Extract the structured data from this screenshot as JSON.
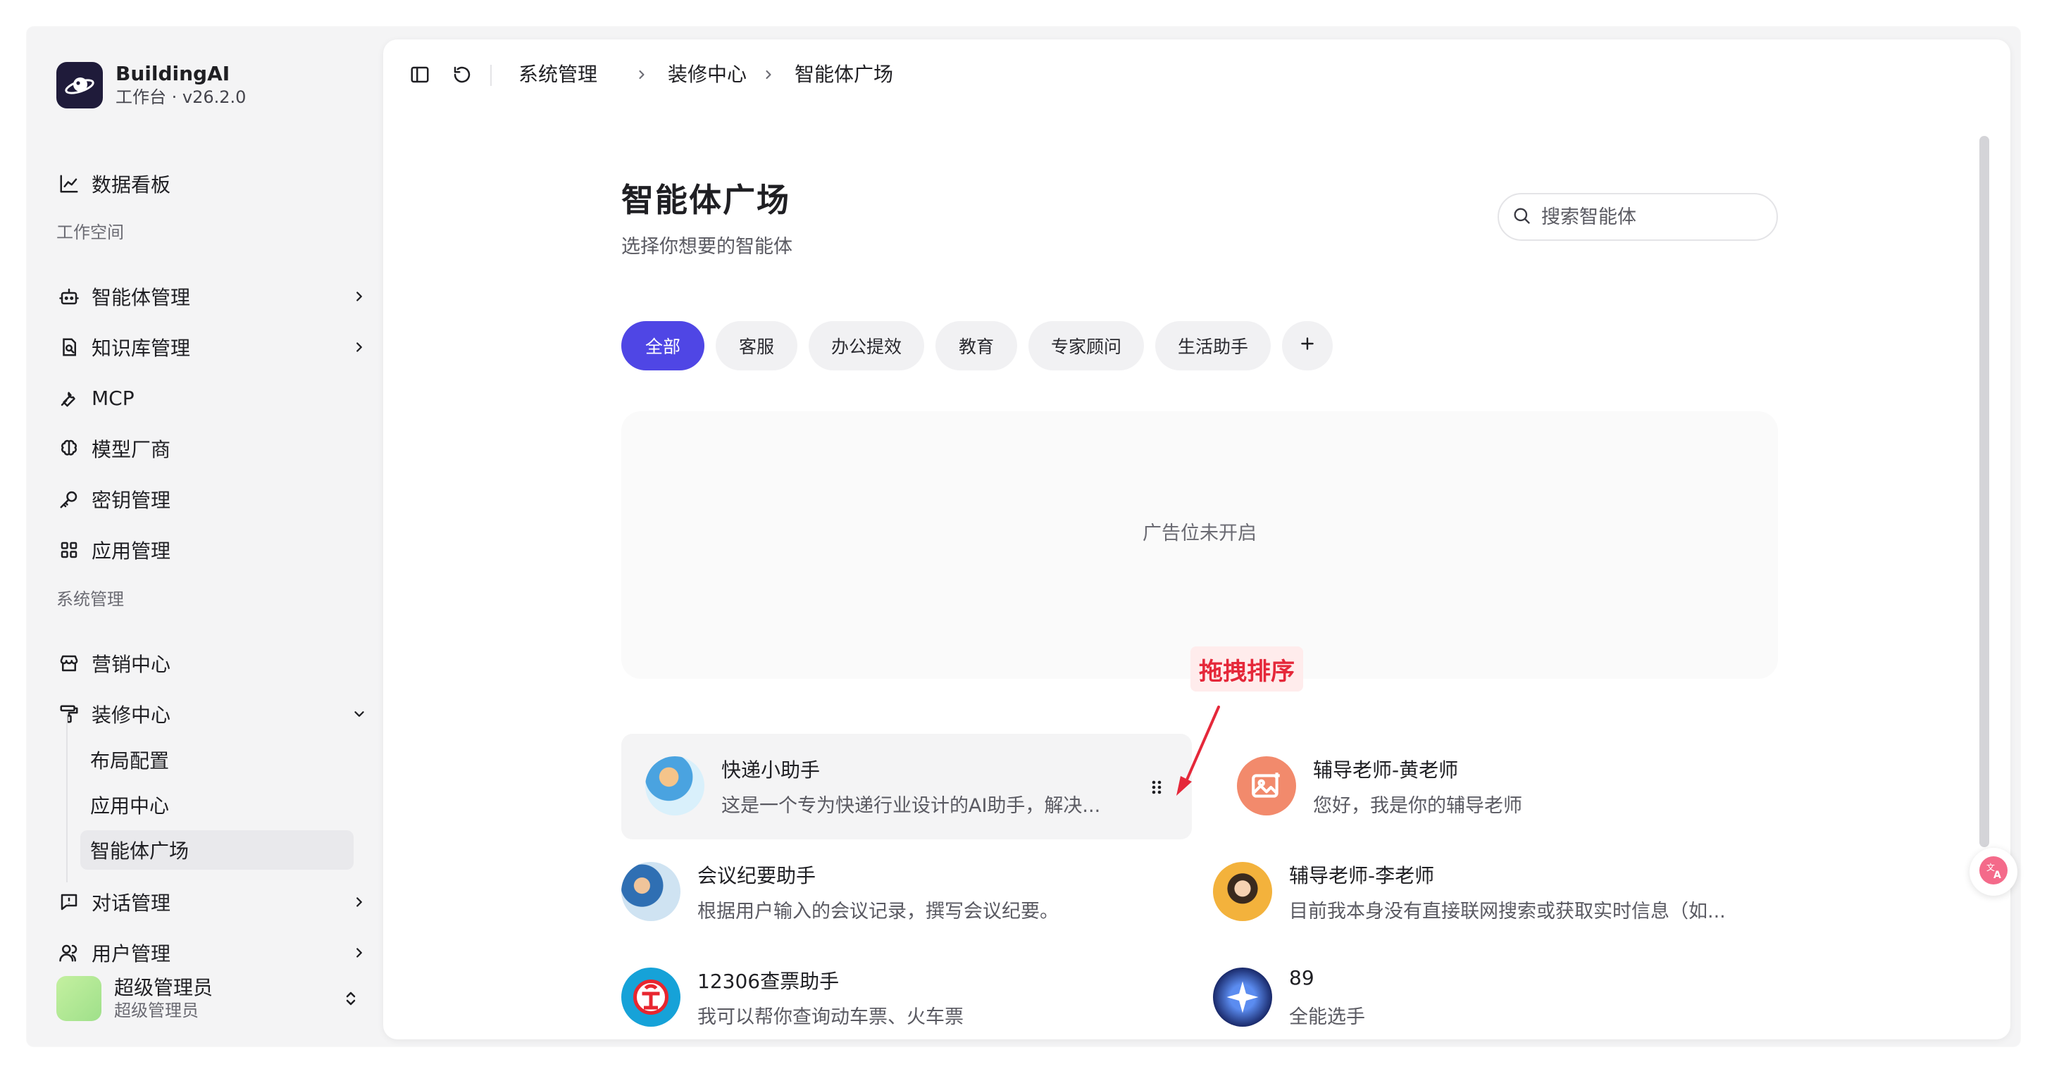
{
  "brand": {
    "name": "BuildingAI",
    "subtitle": "工作台 · v26.2.0"
  },
  "sidebar": {
    "dashboard": "数据看板",
    "section_workspace": "工作空间",
    "workspace_items": [
      {
        "label": "智能体管理",
        "icon": "robot-icon"
      },
      {
        "label": "知识库管理",
        "icon": "book-search-icon"
      },
      {
        "label": "MCP",
        "icon": "wrench-icon"
      },
      {
        "label": "模型厂商",
        "icon": "brain-icon"
      },
      {
        "label": "密钥管理",
        "icon": "key-icon"
      },
      {
        "label": "应用管理",
        "icon": "grid-icon"
      }
    ],
    "section_system": "系统管理",
    "system_items": [
      {
        "label": "营销中心",
        "icon": "store-icon"
      },
      {
        "label": "装修中心",
        "icon": "paint-roller-icon"
      }
    ],
    "decor_sub_items": [
      "布局配置",
      "应用中心",
      "智能体广场"
    ],
    "bottom_items": [
      {
        "label": "对话管理",
        "icon": "chat-icon"
      },
      {
        "label": "用户管理",
        "icon": "users-icon"
      }
    ],
    "user": {
      "name": "超级管理员",
      "role": "超级管理员"
    }
  },
  "breadcrumb": [
    "系统管理",
    "装修中心",
    "智能体广场"
  ],
  "page": {
    "title": "智能体广场",
    "subtitle": "选择你想要的智能体",
    "search_placeholder": "搜索智能体"
  },
  "tabs": [
    "全部",
    "客服",
    "办公提效",
    "教育",
    "专家顾问",
    "生活助手"
  ],
  "ad_text": "广告位未开启",
  "annotation": "拖拽排序",
  "agents": [
    {
      "name": "快递小助手",
      "desc": "这是一个专为快递行业设计的AI助手，解决..."
    },
    {
      "name": "辅导老师-黄老师",
      "desc": "您好，我是你的辅导老师"
    },
    {
      "name": "会议纪要助手",
      "desc": "根据用户输入的会议记录，撰写会议纪要。"
    },
    {
      "name": "辅导老师-李老师",
      "desc": "目前我本身没有直接联网搜索或获取实时信息（如..."
    },
    {
      "name": "12306查票助手",
      "desc": "我可以帮你查询动车票、火车票"
    },
    {
      "name": "89",
      "desc": "全能选手"
    }
  ],
  "colors": {
    "accent": "#4f46e5",
    "annotation": "#e5283a"
  }
}
